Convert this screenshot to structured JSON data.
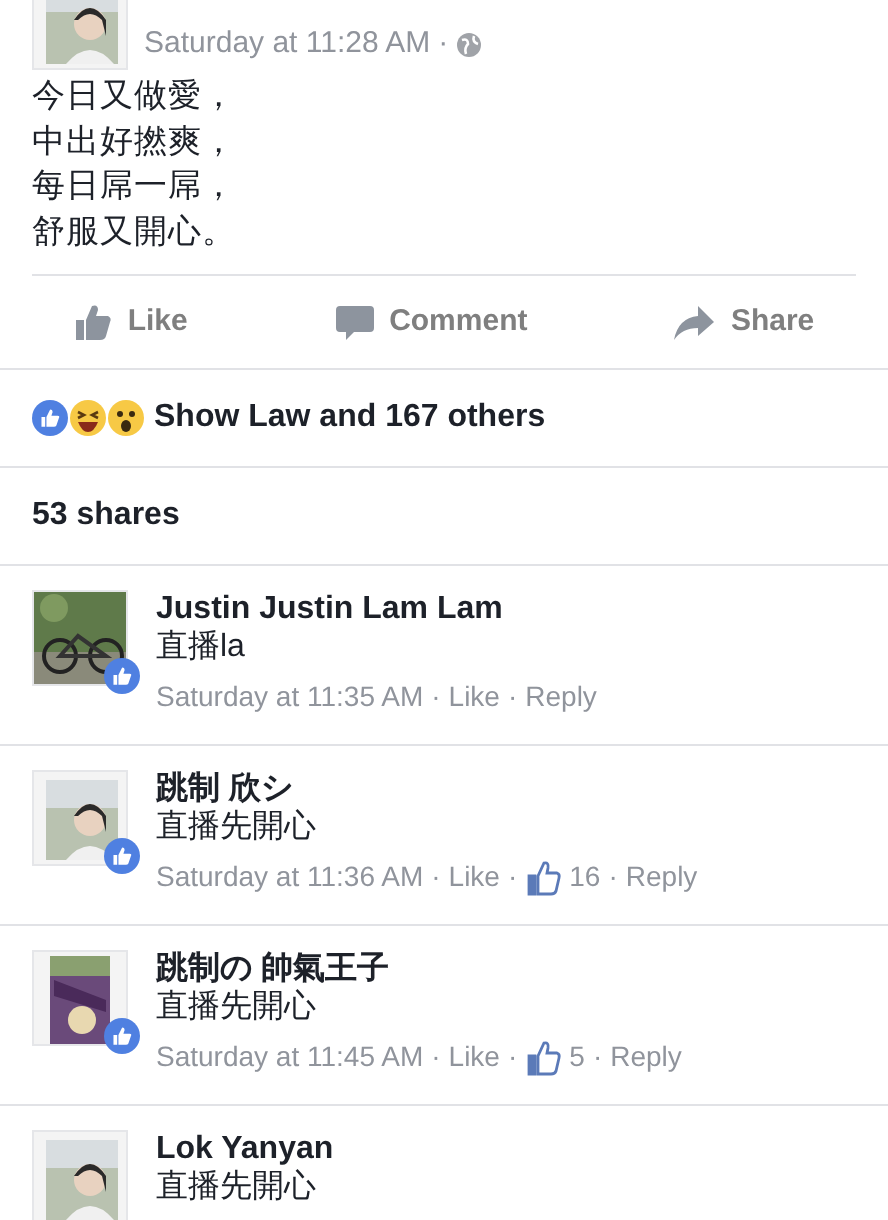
{
  "post": {
    "time": "Saturday at 11:28 AM",
    "time_sep": "·",
    "lines": [
      "今日又做愛，",
      "中出好撚爽，",
      "每日屌一屌，",
      "舒服又開心。"
    ]
  },
  "actions": [
    {
      "kind": "like",
      "label": "Like"
    },
    {
      "kind": "comment",
      "label": "Comment"
    },
    {
      "kind": "share",
      "label": "Share"
    }
  ],
  "reactions": {
    "text": "Show Law and 167 others"
  },
  "shares": "53 shares",
  "comments": [
    {
      "name": "Justin Justin Lam Lam",
      "text": "直播la",
      "liked_post": true,
      "meta": [
        {
          "kind": "time",
          "text": "Saturday at 11:35 AM"
        },
        {
          "kind": "sep",
          "text": "·"
        },
        {
          "kind": "link",
          "text": "Like"
        },
        {
          "kind": "sep",
          "text": "·"
        },
        {
          "kind": "link",
          "text": "Reply"
        }
      ]
    },
    {
      "name": "跳制 欣シ",
      "text": "直播先開心",
      "liked_post": true,
      "meta": [
        {
          "kind": "time",
          "text": "Saturday at 11:36 AM"
        },
        {
          "kind": "sep",
          "text": "·"
        },
        {
          "kind": "link",
          "text": "Like"
        },
        {
          "kind": "sep",
          "text": "·"
        },
        {
          "kind": "likes",
          "text": "16"
        },
        {
          "kind": "sep",
          "text": "·"
        },
        {
          "kind": "link",
          "text": "Reply"
        }
      ]
    },
    {
      "name": "跳制の 帥氣王子",
      "text": "直播先開心",
      "liked_post": true,
      "meta": [
        {
          "kind": "time",
          "text": "Saturday at 11:45 AM"
        },
        {
          "kind": "sep",
          "text": "·"
        },
        {
          "kind": "link",
          "text": "Like"
        },
        {
          "kind": "sep",
          "text": "·"
        },
        {
          "kind": "likes",
          "text": "5"
        },
        {
          "kind": "sep",
          "text": "·"
        },
        {
          "kind": "link",
          "text": "Reply"
        }
      ]
    },
    {
      "name": "Lok Yanyan",
      "text": "直播先開心"
    }
  ]
}
